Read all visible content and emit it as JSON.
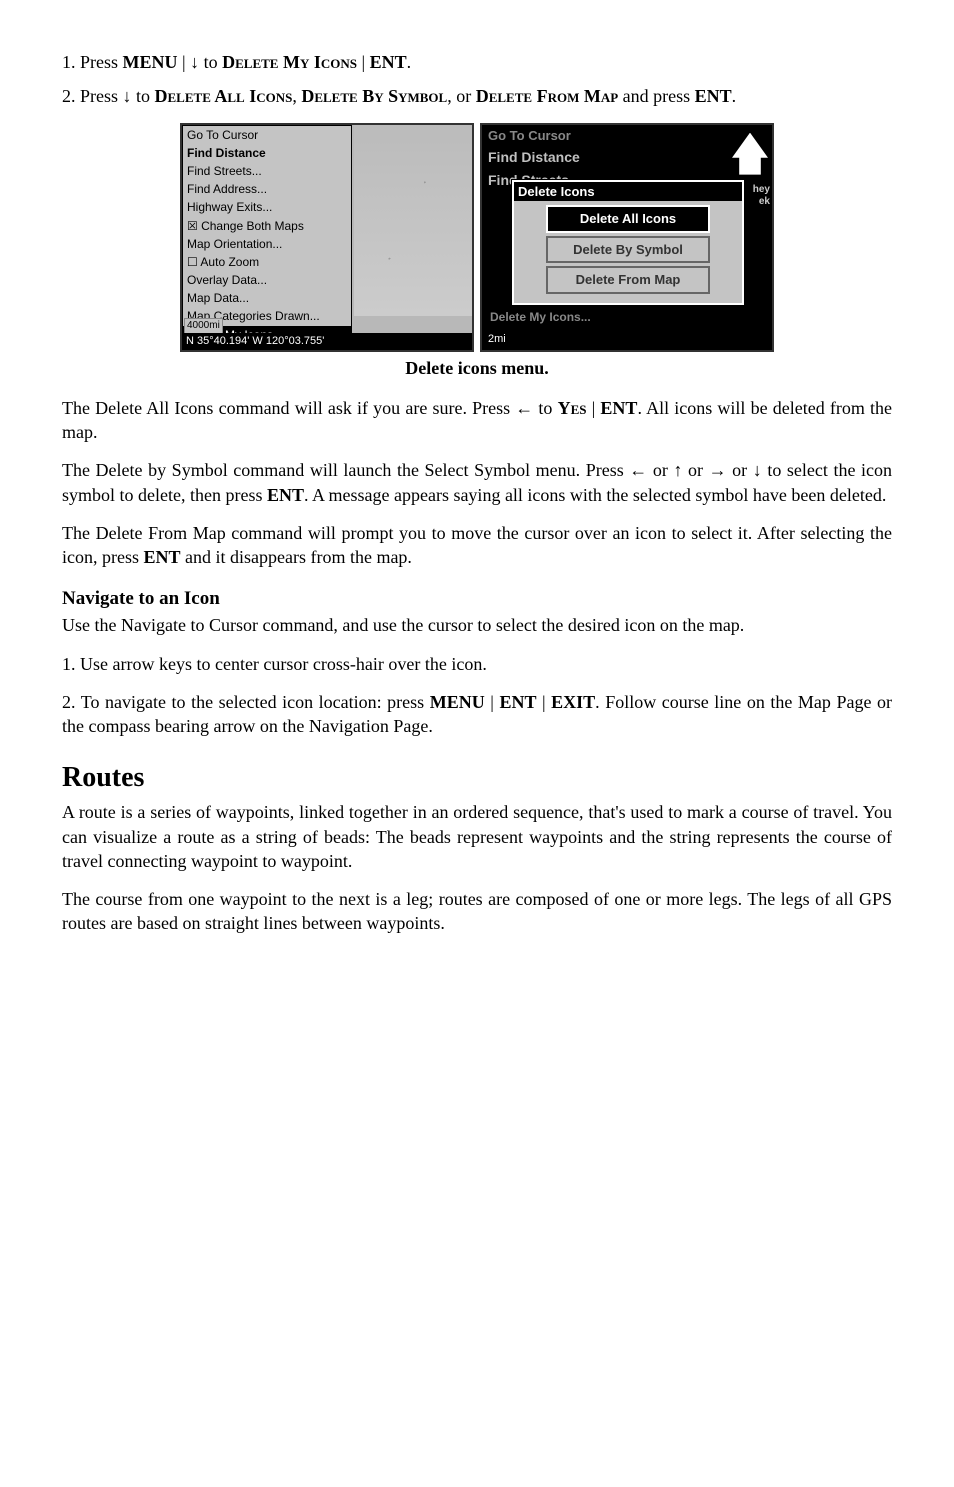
{
  "step1": {
    "prefix": "1. Press ",
    "menu": "MENU",
    "sep1": " | ↓ to ",
    "action": "Delete My Icons",
    "sep2": " | ",
    "ent": "ENT",
    "tail": "."
  },
  "step2": {
    "prefix": "2. Press ↓ to ",
    "a1": "Delete All Icons",
    "c1": ", ",
    "a2": "Delete By Symbol",
    "c2": ", or ",
    "a3": "Delete From Map",
    "mid": " and press ",
    "ent": "ENT",
    "tail": "."
  },
  "left_menu": {
    "items": [
      "Go To Cursor",
      "Find Distance",
      "Find Streets...",
      "Find Address...",
      "Highway Exits...",
      "☒ Change Both Maps",
      "Map Orientation...",
      "☐ Auto Zoom",
      "Overlay Data...",
      "Map Data...",
      "Map Categories Drawn..."
    ],
    "highlighted": "Delete My Icons...",
    "scale": "4000mi",
    "coords": "N  35°40.194'  W 120°03.755'"
  },
  "right_menu": {
    "back_items": [
      "Go To Cursor",
      "Find Distance",
      "Find Streets..."
    ],
    "popup_title": "Delete Icons",
    "buttons": [
      "Delete All Icons",
      "Delete By Symbol",
      "Delete From Map"
    ],
    "back_footer": "Delete My Icons...",
    "mi": "2mi",
    "side_text_top": "hey",
    "side_text_bot": "ek"
  },
  "caption": "Delete icons menu.",
  "para_delete_all": {
    "t1": "The Delete All Icons command will ask if you are sure. Press ← to ",
    "yes": "Yes",
    "sep": " | ",
    "ent": "ENT",
    "t2": ". All icons will be deleted from the map."
  },
  "para_delete_symbol": {
    "t1": "The Delete by Symbol command will launch the Select Symbol menu. Press ← or ↑ or → or ↓ to select the icon symbol to delete, then press ",
    "ent": "ENT",
    "t2": ". A message appears saying all icons with the selected symbol have been deleted."
  },
  "para_delete_map": {
    "t1": "The Delete From Map command will prompt you to move the cursor over an icon to select it. After selecting the icon, press ",
    "ent": "ENT",
    "t2": " and it disappears from the map."
  },
  "nav_head": "Navigate to an Icon",
  "nav_intro": "Use the Navigate to Cursor command, and use the cursor to select the desired icon on the map.",
  "nav_step1": "1. Use arrow keys to center cursor cross-hair over the icon.",
  "nav_step2": {
    "t1": "2. To navigate to the selected icon location: press ",
    "menu": "MENU",
    "sep1": " | ",
    "ent": "ENT",
    "sep2": " | ",
    "exit": "EXIT",
    "t2": ". Follow course line on the Map Page or the compass bearing arrow on the Navigation Page."
  },
  "routes_head": "Routes",
  "routes_p1": "A route is a series of waypoints, linked together in an ordered sequence, that's used to mark a course of travel. You can visualize a route as a string of beads: The beads represent waypoints and the string represents the course of travel connecting waypoint to waypoint.",
  "routes_p2": "The course from one waypoint to the next is a leg; routes are composed of one or more legs. The legs of all GPS routes are based on straight lines between waypoints."
}
